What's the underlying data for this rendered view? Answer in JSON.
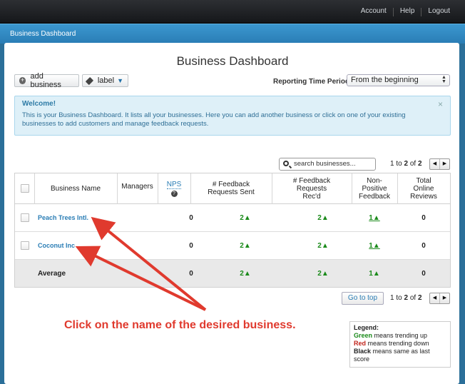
{
  "topnav": {
    "links": [
      "Account",
      "Help",
      "Logout"
    ]
  },
  "header": {
    "breadcrumb": "Business Dashboard"
  },
  "page": {
    "title": "Business Dashboard"
  },
  "toolbar": {
    "add_business_label": "add business",
    "label_button_label": "label",
    "reporting_label": "Reporting Time Period",
    "reporting_value": "From the beginning"
  },
  "welcome": {
    "title": "Welcome!",
    "body": "This is your Business Dashboard. It lists all your businesses. Here you can add another business or click on one of your existing businesses to add customers and manage feedback requests.",
    "close": "×"
  },
  "search": {
    "placeholder": "search businesses..."
  },
  "pager_top": {
    "prefix": "1 to",
    "current": "2",
    "of": "of",
    "total": "2"
  },
  "pager_bottom": {
    "prefix": "1 to",
    "current": "2",
    "of": "of",
    "total": "2"
  },
  "table": {
    "headers": {
      "business_name": "Business Name",
      "managers": "Managers",
      "nps": "NPS",
      "sent": "# Feedback Requests Sent",
      "recd": "# Feedback Requests Rec'd",
      "nonpositive": "Non-Positive Feedback",
      "reviews": "Total Online Reviews"
    },
    "rows": [
      {
        "name": "Peach Trees Intl.",
        "managers": "",
        "nps": "0",
        "sent": "2▲",
        "recd": "2▲",
        "nonpositive": "1▲",
        "reviews": "0"
      },
      {
        "name": "Coconut Inc",
        "managers": "",
        "nps": "0",
        "sent": "2▲",
        "recd": "2▲",
        "nonpositive": "1▲",
        "reviews": "0"
      }
    ],
    "average": {
      "label": "Average",
      "nps": "0",
      "sent": "2▲",
      "recd": "2▲",
      "nonpositive": "1▲",
      "reviews": "0"
    }
  },
  "goto_top": "Go to top",
  "legend": {
    "title": "Legend:",
    "green_word": "Green",
    "green_text": " means trending up",
    "red_word": "Red",
    "red_text": " means trending down",
    "black_word": "Black",
    "black_text": " means same as last score"
  },
  "annotation": "Click on the name of the desired business.",
  "colors": {
    "accent": "#2a7db5",
    "trend_up": "#1a8a1a",
    "annotation": "#e03a2e"
  }
}
